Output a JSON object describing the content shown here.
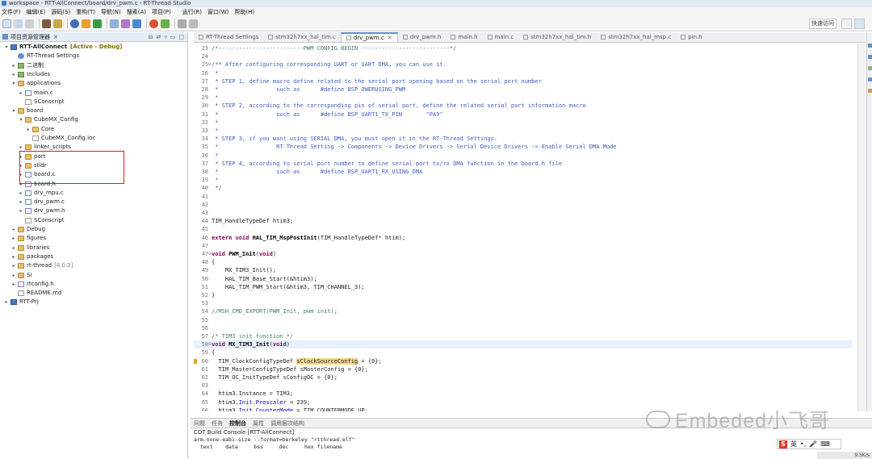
{
  "window": {
    "title": "workspace - RTT-AllConnect/board/drv_pwm.c - RT-Thread Studio"
  },
  "menu": [
    "文件(F)",
    "编辑(E)",
    "源码(S)",
    "重构(T)",
    "导航(N)",
    "搜索(A)",
    "项目(P)",
    "",
    "运行(R)",
    "窗口(W)",
    "帮助(H)"
  ],
  "quick_access": "快速访问",
  "project_explorer": {
    "tab_label": "项目资源管理器",
    "items": [
      {
        "label": "RTT-AllConnect",
        "deco": "[Active - Debug]",
        "depth": 0,
        "arrow": "▾",
        "icon": "project",
        "bold": true
      },
      {
        "label": "RT-Thread Settings",
        "depth": 1,
        "arrow": "",
        "icon": "gear"
      },
      {
        "label": "二进制",
        "depth": 1,
        "arrow": "▸",
        "icon": "lib"
      },
      {
        "label": "Includes",
        "depth": 1,
        "arrow": "▸",
        "icon": "lib"
      },
      {
        "label": "applications",
        "depth": 1,
        "arrow": "▾",
        "icon": "folder"
      },
      {
        "label": "main.c",
        "depth": 2,
        "arrow": "▸",
        "icon": "file-c"
      },
      {
        "label": "SConscript",
        "depth": 2,
        "arrow": "",
        "icon": "file-gen"
      },
      {
        "label": "board",
        "depth": 1,
        "arrow": "▾",
        "icon": "folder"
      },
      {
        "label": "CubeMX_Config",
        "depth": 2,
        "arrow": "▾",
        "icon": "folder"
      },
      {
        "label": "Core",
        "depth": 3,
        "arrow": "▸",
        "icon": "folder"
      },
      {
        "label": "CubeMX_Config.ioc",
        "depth": 3,
        "arrow": "",
        "icon": "file-gen"
      },
      {
        "label": "linker_scripts",
        "depth": 2,
        "arrow": "▸",
        "icon": "folder"
      },
      {
        "label": "port",
        "depth": 2,
        "arrow": "▸",
        "icon": "folder"
      },
      {
        "label": "stldr",
        "depth": 2,
        "arrow": "▸",
        "icon": "folder"
      },
      {
        "label": "board.c",
        "depth": 2,
        "arrow": "▸",
        "icon": "file-c"
      },
      {
        "label": "board.h",
        "depth": 2,
        "arrow": "▸",
        "icon": "file-h"
      },
      {
        "label": "drv_mpu.c",
        "depth": 2,
        "arrow": "▸",
        "icon": "file-c"
      },
      {
        "label": "drv_pwm.c",
        "depth": 2,
        "arrow": "▸",
        "icon": "file-c"
      },
      {
        "label": "drv_pwm.h",
        "depth": 2,
        "arrow": "▸",
        "icon": "file-h"
      },
      {
        "label": "SConscript",
        "depth": 2,
        "arrow": "",
        "icon": "file-gen"
      },
      {
        "label": "Debug",
        "depth": 1,
        "arrow": "▸",
        "icon": "folder"
      },
      {
        "label": "figures",
        "depth": 1,
        "arrow": "▸",
        "icon": "folder"
      },
      {
        "label": "libraries",
        "depth": 1,
        "arrow": "▸",
        "icon": "folder"
      },
      {
        "label": "packages",
        "depth": 1,
        "arrow": "▸",
        "icon": "folder"
      },
      {
        "label": "rt-thread",
        "deco": "[4.0.3]",
        "depth": 1,
        "arrow": "▸",
        "icon": "folder"
      },
      {
        "label": "SI",
        "depth": 1,
        "arrow": "▸",
        "icon": "folder"
      },
      {
        "label": "rtconfig.h",
        "depth": 1,
        "arrow": "▸",
        "icon": "file-h"
      },
      {
        "label": "README.md",
        "depth": 1,
        "arrow": "",
        "icon": "file-gen"
      },
      {
        "label": "RTT-Prj",
        "depth": 0,
        "arrow": "▸",
        "icon": "project"
      }
    ]
  },
  "editor_tabs": [
    {
      "label": "RT-Thread Settings",
      "active": false
    },
    {
      "label": "stm32h7xx_hal_tim.c",
      "active": false
    },
    {
      "label": "drv_pwm.c",
      "active": true
    },
    {
      "label": "drv_pwm.h",
      "active": false
    },
    {
      "label": "main.h",
      "active": false
    },
    {
      "label": "main.c",
      "active": false
    },
    {
      "label": "stm32h7xx_hal_tim.h",
      "active": false
    },
    {
      "label": "stm32h7xx_hal_msp.c",
      "active": false
    },
    {
      "label": "pin.h",
      "active": false
    }
  ],
  "code_lines": [
    {
      "n": "23",
      "segs": [
        {
          "c": "cm",
          "t": "/*-------------------------PWM CONFIG BEGIN --------------------------*/"
        }
      ]
    },
    {
      "n": "24",
      "segs": []
    },
    {
      "n": "25",
      "fold": "⊖",
      "segs": [
        {
          "c": "cmb",
          "t": "/** After configuring corresponding UART or UART DMA, you can use it."
        }
      ]
    },
    {
      "n": "26",
      "segs": [
        {
          "c": "cmb",
          "t": " *"
        }
      ]
    },
    {
      "n": "27",
      "segs": [
        {
          "c": "cmb",
          "t": " * STEP 1, define macro define related to the serial port opening based on the serial port number"
        }
      ]
    },
    {
      "n": "28",
      "segs": [
        {
          "c": "cmb",
          "t": " *                 such as      #define BSP_OWERUSING_PWM"
        }
      ]
    },
    {
      "n": "29",
      "segs": [
        {
          "c": "cmb",
          "t": " *"
        }
      ]
    },
    {
      "n": "30",
      "segs": [
        {
          "c": "cmb",
          "t": " * STEP 2, according to the corresponding pin of serial port, define the related serial port information macro"
        }
      ]
    },
    {
      "n": "31",
      "segs": [
        {
          "c": "cmb",
          "t": " *                 such as      #define BSP_UART1_TX_PIN       \"PA9\""
        }
      ]
    },
    {
      "n": "32",
      "segs": [
        {
          "c": "cmb",
          "t": " *"
        }
      ]
    },
    {
      "n": "33",
      "segs": [
        {
          "c": "cmb",
          "t": " *"
        }
      ]
    },
    {
      "n": "34",
      "segs": [
        {
          "c": "cmb",
          "t": " * STEP 3, if you want using SERIAL DMA, you must open it in the RT-Thread Settings."
        }
      ]
    },
    {
      "n": "35",
      "segs": [
        {
          "c": "cmb",
          "t": " *                 RT-Thread Setting -> Components -> Device Drivers -> Serial Device Drivers -> Enable Serial DMA Mode"
        }
      ]
    },
    {
      "n": "36",
      "segs": [
        {
          "c": "cmb",
          "t": " *"
        }
      ]
    },
    {
      "n": "37",
      "segs": [
        {
          "c": "cmb",
          "t": " * STEP 4, according to serial port number to define serial port tx/rx DMA function in the board.h file"
        }
      ]
    },
    {
      "n": "38",
      "segs": [
        {
          "c": "cmb",
          "t": " *                 such as      #define BSP_UART1_RX_USING_DMA"
        }
      ]
    },
    {
      "n": "39",
      "segs": [
        {
          "c": "cmb",
          "t": " *"
        }
      ]
    },
    {
      "n": "40",
      "segs": [
        {
          "c": "cmb",
          "t": " */"
        }
      ]
    },
    {
      "n": "41",
      "segs": []
    },
    {
      "n": "42",
      "segs": []
    },
    {
      "n": "43",
      "segs": []
    },
    {
      "n": "44",
      "segs": [
        {
          "c": "",
          "t": "TIM_HandleTypeDef htim3;"
        }
      ]
    },
    {
      "n": "45",
      "segs": []
    },
    {
      "n": "46",
      "segs": [
        {
          "c": "kw",
          "t": "extern void "
        },
        {
          "c": "fn",
          "t": "HAL_TIM_MspPostInit"
        },
        {
          "c": "",
          "t": "(TIM_HandleTypeDef* htim);"
        }
      ]
    },
    {
      "n": "47",
      "segs": []
    },
    {
      "n": "47",
      "fold": "⊖",
      "segs": [
        {
          "c": "kw",
          "t": "void "
        },
        {
          "c": "fn",
          "t": "PWM_Init"
        },
        {
          "c": "",
          "t": "("
        },
        {
          "c": "kw",
          "t": "void"
        },
        {
          "c": "",
          "t": ")"
        }
      ]
    },
    {
      "n": "48",
      "segs": [
        {
          "c": "",
          "t": "{"
        }
      ]
    },
    {
      "n": "49",
      "segs": [
        {
          "c": "",
          "t": "    MX_TIM3_Init();"
        }
      ]
    },
    {
      "n": "50",
      "segs": [
        {
          "c": "",
          "t": "    HAL_TIM_Base_Start(&htim3);"
        }
      ]
    },
    {
      "n": "51",
      "segs": [
        {
          "c": "",
          "t": "    HAL_TIM_PWM_Start(&htim3, TIM_CHANNEL_3);"
        }
      ]
    },
    {
      "n": "52",
      "segs": [
        {
          "c": "",
          "t": "}"
        }
      ]
    },
    {
      "n": "53",
      "segs": []
    },
    {
      "n": "54",
      "segs": [
        {
          "c": "cm",
          "t": "//MSH_CMD_EXPORT(PWM_Init, pwm init);"
        }
      ]
    },
    {
      "n": "55",
      "segs": []
    },
    {
      "n": "56",
      "segs": []
    },
    {
      "n": "57",
      "segs": [
        {
          "c": "cm",
          "t": "/* TIM3 init function */"
        }
      ]
    },
    {
      "n": "58",
      "fold": "⊖",
      "current": true,
      "segs": [
        {
          "c": "kw",
          "t": "void "
        },
        {
          "c": "fn",
          "t": "MX_TIM3_Init"
        },
        {
          "c": "",
          "t": "("
        },
        {
          "c": "kw",
          "t": "void"
        },
        {
          "c": "",
          "t": ")"
        }
      ]
    },
    {
      "n": "59",
      "segs": [
        {
          "c": "",
          "t": "{"
        }
      ]
    },
    {
      "n": "60",
      "marker": true,
      "segs": [
        {
          "c": "",
          "t": "  TIM_ClockConfigTypeDef "
        },
        {
          "c": "hl",
          "t": "sClockSourceConfig"
        },
        {
          "c": "",
          "t": " = {0};"
        }
      ]
    },
    {
      "n": "61",
      "segs": [
        {
          "c": "",
          "t": "  TIM_MasterConfigTypeDef sMasterConfig = {0};"
        }
      ]
    },
    {
      "n": "62",
      "segs": [
        {
          "c": "",
          "t": "  TIM_OC_InitTypeDef sConfigOC = {0};"
        }
      ]
    },
    {
      "n": "63",
      "segs": []
    },
    {
      "n": "64",
      "segs": [
        {
          "c": "",
          "t": "  htim3.Instance = TIM3;"
        }
      ]
    },
    {
      "n": "65",
      "segs": [
        {
          "c": "",
          "t": "  htim3."
        },
        {
          "c": "mem",
          "t": "Init"
        },
        {
          "c": "",
          "t": "."
        },
        {
          "c": "mem",
          "t": "Prescaler"
        },
        {
          "c": "",
          "t": " = 239;"
        }
      ]
    },
    {
      "n": "66",
      "segs": [
        {
          "c": "",
          "t": "  htim3."
        },
        {
          "c": "mem",
          "t": "Init"
        },
        {
          "c": "",
          "t": "."
        },
        {
          "c": "mem",
          "t": "CounterMode"
        },
        {
          "c": "",
          "t": " = TIM_COUNTERMODE_UP;"
        }
      ]
    }
  ],
  "console": {
    "tabs": [
      "问题",
      "任务",
      "控制台",
      "属性",
      "调用层次结构"
    ],
    "active_tab": "控制台",
    "title": "CDT Build Console [RTT-AllConnect]",
    "lines": [
      "arm-none-eabi-size --format=berkeley \"rtthread.elf\"",
      "  text    data     bss     dec     hex filename"
    ]
  },
  "watermark": "Embeded小飞哥",
  "ime": {
    "logo": "S",
    "lang": "英"
  },
  "status": "9.5K/s",
  "colors": {
    "accent": "#5a8fd6",
    "selection_box": "#e01818",
    "keyword": "#7f0055",
    "comment": "#3f7f5f"
  }
}
